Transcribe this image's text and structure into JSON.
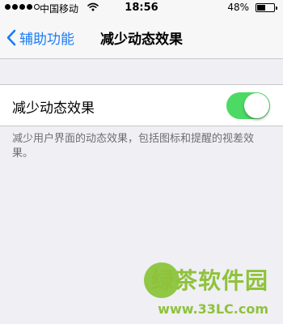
{
  "status_bar": {
    "carrier": "中国移动",
    "time": "18:56",
    "battery_percent": "48%",
    "battery_level": 0.48,
    "signal_bars_filled": 4,
    "signal_bars_total": 5
  },
  "nav": {
    "back_label": "辅助功能",
    "title": "减少动态效果"
  },
  "setting": {
    "label": "减少动态效果",
    "enabled": true
  },
  "footer_text": "减少用户界面的动态效果，包括图标和提醒的视差效果。",
  "watermark": {
    "brand": "绿茶软件园",
    "url": "www.33LC.com"
  },
  "colors": {
    "accent": "#1b7cf6",
    "switch_on": "#4cd964",
    "background": "#efeff4",
    "watermark": "#8fc23a"
  },
  "icons": {
    "back": "chevron-left-icon",
    "wifi": "wifi-icon",
    "battery": "battery-icon"
  }
}
